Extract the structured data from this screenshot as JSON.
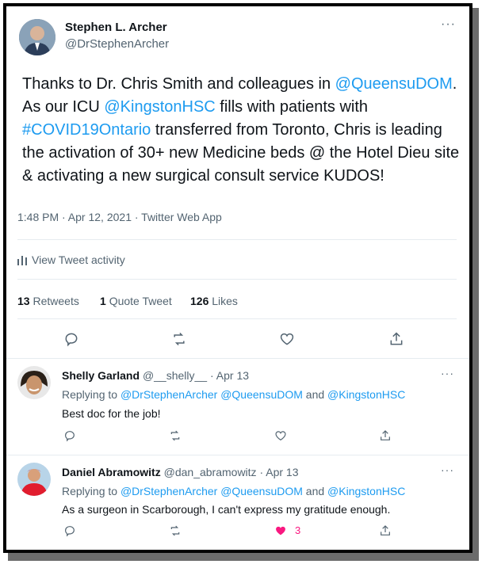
{
  "author": {
    "name": "Stephen L. Archer",
    "handle": "@DrStephenArcher"
  },
  "tweet": {
    "t1": "Thanks to Dr. Chris Smith and colleagues in ",
    "m1": "@QueensuDOM",
    "t2": ". As our ICU ",
    "m2": "@KingstonHSC",
    "t3": " fills with patients with ",
    "h1": "#COVID19Ontario",
    "t4": " transferred from Toronto, Chris  is leading the activation of 30+ new Medicine beds @ the Hotel Dieu site & activating a new surgical consult service KUDOS!",
    "timestamp": "1:48 PM · Apr 12, 2021 · Twitter Web App",
    "activity_label": "View Tweet activity",
    "retweets_count": "13",
    "retweets_label": "Retweets",
    "quotes_count": "1",
    "quotes_label": "Quote Tweet",
    "likes_count": "126",
    "likes_label": "Likes"
  },
  "more_glyph": "···",
  "replies": [
    {
      "name": "Shelly Garland",
      "handle": "@__shelly__",
      "date": "· Apr 13",
      "replying_prefix": "Replying to ",
      "replying_to": "@DrStephenArcher @QueensuDOM",
      "replying_and": " and ",
      "replying_last": "@KingstonHSC",
      "text": "Best doc for the job!",
      "like_count": ""
    },
    {
      "name": "Daniel Abramowitz",
      "handle": "@dan_abramowitz",
      "date": "· Apr 13",
      "replying_prefix": "Replying to ",
      "replying_to": "@DrStephenArcher @QueensuDOM",
      "replying_and": " and ",
      "replying_last": "@KingstonHSC",
      "text": "As a surgeon in Scarborough, I can't express my gratitude enough.",
      "like_count": "3"
    }
  ],
  "colors": {
    "link": "#1d9bf0",
    "muted": "#536471",
    "liked": "#f91880"
  }
}
